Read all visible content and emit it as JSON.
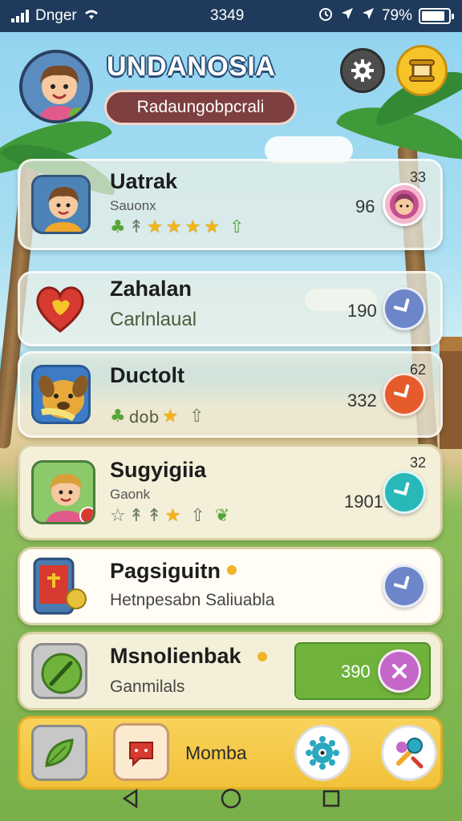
{
  "status_bar": {
    "carrier": "Dnger",
    "time": "3349",
    "battery": "79%",
    "battery_level": 0.79
  },
  "header": {
    "title": "UNDANOSIA",
    "subtitle": "Radaungobpcrali"
  },
  "list": [
    {
      "title": "Uatrak",
      "subtitle": "Sauonx",
      "score": "96",
      "top_number": "33",
      "icon": "boy-portrait-icon",
      "button_icon": "girl-avatar-icon",
      "stars": 4
    },
    {
      "title": "Zahalan",
      "subtitle": "Carlnlaual",
      "score": "190",
      "icon": "heart-icon",
      "button_color": "#6c86c9",
      "button_icon": "arrow-icon"
    },
    {
      "title": "Ductolt",
      "subtitle": "dob",
      "score": "332",
      "top_number": "62",
      "icon": "dog-face-icon",
      "button_color": "#e65b2b",
      "button_icon": "arrow-icon"
    },
    {
      "title": "Sugyigiia",
      "subtitle": "Gaonk",
      "score": "1901",
      "top_number": "32",
      "icon": "girl-portrait-icon",
      "button_color": "#28b8b8",
      "button_icon": "arrow-icon"
    },
    {
      "title": "Pagsiguitn",
      "subtitle": "Hetnpesabn Saliuabla",
      "icon": "tablet-icon",
      "button_color": "#6c86c9",
      "button_icon": "arrow-icon"
    },
    {
      "title": "Msnolienbak",
      "subtitle": "Ganmilals",
      "score": "390",
      "icon": "green-leaf-icon",
      "button_color": "#c566c9",
      "button_icon": "close-icon"
    }
  ],
  "bottom_bar": {
    "label": "Momba"
  },
  "colors": {
    "status_bar": "#1f3a5c",
    "bottom_bar": "#f2c23a",
    "green_bar": "#6fb33c"
  }
}
